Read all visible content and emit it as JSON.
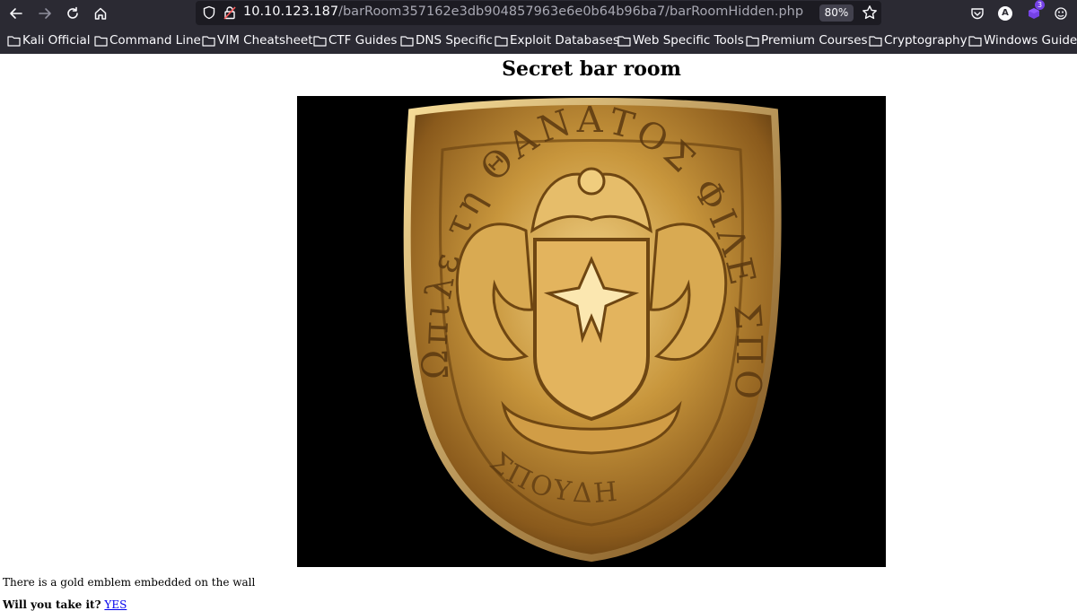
{
  "browser": {
    "url_host": "10.10.123.187",
    "url_path": "/barRoom357162e3db904857963e6e0b64b96ba7/barRoomHidden.php",
    "zoom": "80%",
    "profile_initial": "A",
    "extension_badge": "3",
    "icons": {
      "back": "back-arrow-icon",
      "forward": "forward-arrow-icon",
      "reload": "reload-icon",
      "home": "home-icon",
      "tracking": "shield-icon",
      "insecure": "insecure-lock-icon",
      "bookmark_star": "star-icon",
      "pocket": "pocket-icon",
      "account": "account-icon",
      "extension": "extension-icon",
      "settings": "settings-icon"
    }
  },
  "bookmarks": [
    {
      "label": "Kali Official"
    },
    {
      "label": "Command Line"
    },
    {
      "label": "VIM Cheatsheet"
    },
    {
      "label": "CTF Guides"
    },
    {
      "label": "DNS Specific"
    },
    {
      "label": "Exploit Databases"
    },
    {
      "label": "Web Specific Tools"
    },
    {
      "label": "Premium Courses"
    },
    {
      "label": "Cryptography"
    },
    {
      "label": "Windows Guide"
    }
  ],
  "page": {
    "title": "Secret bar room",
    "image_text": "Ωπιλε τη ΘΑΝΑΤΟΣ ΦΙΛΕ ΣΠΟΥΔΗ",
    "description": "There is a gold emblem embedded on the wall",
    "question": "Will you take it?",
    "yes_link": "YES"
  },
  "colors": {
    "chrome_bg": "#2b2a33",
    "urlbar_bg": "#1c1b22",
    "link": "#0000ee",
    "emblem_gold": "#c8963c"
  }
}
